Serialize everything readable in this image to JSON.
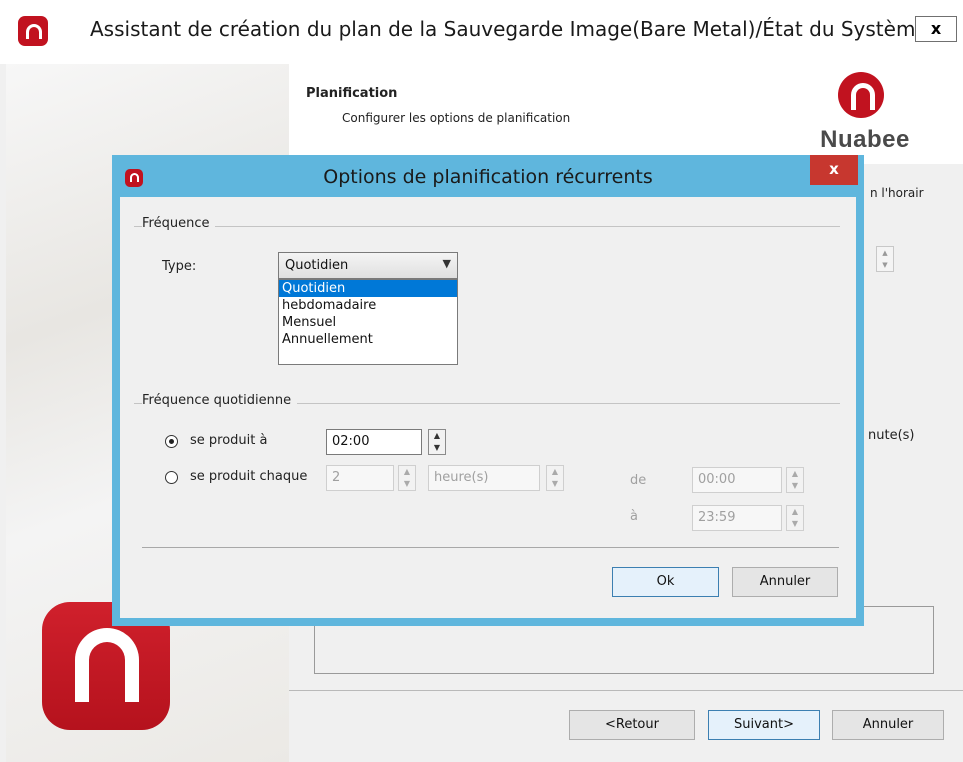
{
  "wizard": {
    "title": "Assistant de création du plan de la Sauvegarde Image(Bare Metal)/État du Système",
    "close": "x",
    "step_title": "Planification",
    "step_desc": "Configurer les options de planification",
    "logo_text": "Nuabee",
    "partial_text_1": "n l'horair",
    "partial_text_2": "nute(s)",
    "buttons": {
      "back": "<Retour",
      "next": "Suivant>",
      "cancel": "Annuler"
    }
  },
  "dialog": {
    "title": "Options de planification récurrents",
    "close": "x",
    "frequency_group": "Fréquence",
    "type_label": "Type:",
    "type_selected": "Quotidien",
    "type_options": [
      "Quotidien",
      "hebdomadaire",
      "Mensuel",
      "Annuellement"
    ],
    "daily_group": "Fréquence quotidienne",
    "occurs_at_label": "se produit à",
    "occurs_at_value": "02:00",
    "occurs_every_label": "se produit chaque",
    "occurs_every_value": "2",
    "occurs_every_unit": "heure(s)",
    "from_label": "de",
    "from_value": "00:00",
    "to_label": "à",
    "to_value": "23:59",
    "ok": "Ok",
    "cancel": "Annuler"
  },
  "colors": {
    "brand_red": "#c1121f",
    "dialog_frame": "#5fb6dd",
    "selection": "#0078d7",
    "close_red": "#c7372f"
  }
}
